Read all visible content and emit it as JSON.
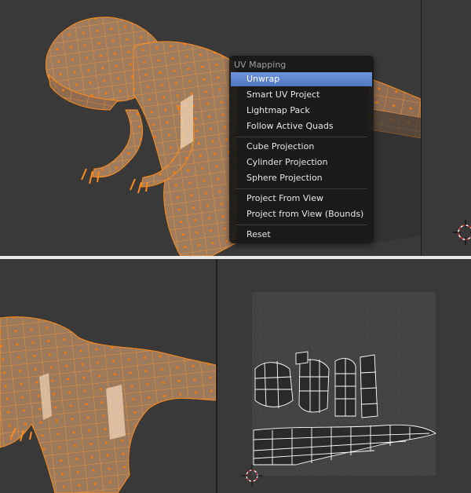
{
  "uv_menu": {
    "title": "UV Mapping",
    "items": [
      {
        "label": "Unwrap",
        "active": true
      },
      {
        "label": "Smart UV Project"
      },
      {
        "label": "Lightmap Pack"
      },
      {
        "label": "Follow Active Quads"
      },
      {
        "label": "Cube Projection"
      },
      {
        "label": "Cylinder Projection"
      },
      {
        "label": "Sphere Projection"
      },
      {
        "label": "Project From View"
      },
      {
        "label": "Project from View (Bounds)"
      },
      {
        "label": "Reset"
      }
    ],
    "highlight_color": "#5a82cc"
  },
  "colors": {
    "mesh_fill": "#a07c5e",
    "mesh_edge": "#ff8c1a",
    "vertex": "#ff7a00",
    "viewport_bg": "#393939",
    "uv_grid_bg": "#444444",
    "uv_line": "#ffffff"
  },
  "icons": {
    "cursor_3d": "3d-cursor-icon",
    "cursor_2d": "2d-cursor-icon"
  }
}
